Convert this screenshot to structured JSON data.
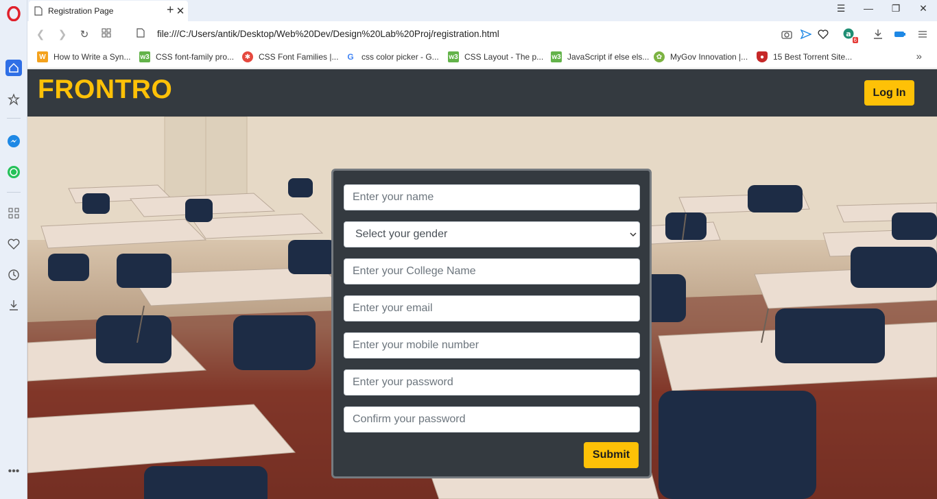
{
  "browser": {
    "tab_title": "Registration Page",
    "url": "file:///C:/Users/antik/Desktop/Web%20Dev/Design%20Lab%20Proj/registration.html",
    "badge_count": "6",
    "bookmarks": [
      {
        "label": "How to Write a Syn...",
        "icon": "w-icon",
        "color": "#f4a21d"
      },
      {
        "label": "CSS font-family pro...",
        "icon": "w3schools-icon",
        "color": "#63b34a"
      },
      {
        "label": "CSS Font Families |...",
        "icon": "flower-icon",
        "color": "#e5483e"
      },
      {
        "label": "css color picker - G...",
        "icon": "google-icon",
        "color": "#4285f4"
      },
      {
        "label": "CSS Layout - The p...",
        "icon": "w3schools-icon",
        "color": "#63b34a"
      },
      {
        "label": "JavaScript if else els...",
        "icon": "w3schools-icon",
        "color": "#63b34a"
      },
      {
        "label": "MyGov Innovation |...",
        "icon": "mygov-icon",
        "color": "#7cb342"
      },
      {
        "label": "15 Best Torrent Site...",
        "icon": "shield-icon",
        "color": "#c62828"
      }
    ]
  },
  "page": {
    "brand": "FRONTRO",
    "login_label": "Log In",
    "form": {
      "name_placeholder": "Enter your name",
      "gender_selected": "Select your gender",
      "college_placeholder": "Enter your College Name",
      "email_placeholder": "Enter your email",
      "mobile_placeholder": "Enter your mobile number",
      "password_placeholder": "Enter your password",
      "confirm_placeholder": "Confirm your password",
      "submit_label": "Submit"
    }
  },
  "colors": {
    "accent": "#fec107",
    "navbar": "#343a40"
  }
}
